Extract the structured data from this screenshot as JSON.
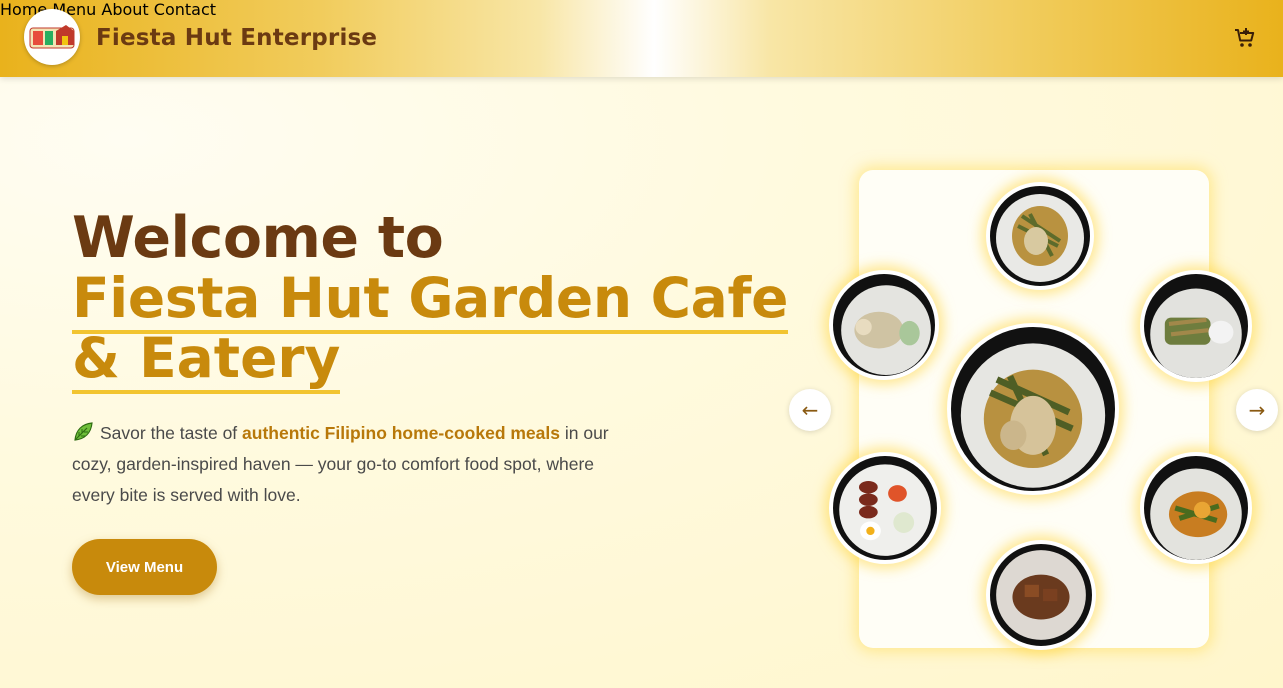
{
  "header": {
    "brand": "Fiesta Hut Enterprise",
    "nav": [
      {
        "label": "Home"
      },
      {
        "label": "Menu"
      },
      {
        "label": "About"
      },
      {
        "label": "Contact"
      }
    ],
    "cart_icon": "cart-icon"
  },
  "hero": {
    "title_line1": "Welcome to",
    "title_line2": "Fiesta Hut Garden Cafe",
    "title_line3": "& Eatery",
    "desc_prefix": "Savor the taste of ",
    "desc_highlight": "authentic Filipino home-cooked meals",
    "desc_suffix": " in our cozy, garden-inspired haven — your go-to comfort food spot, where every bite is served with love.",
    "cta_label": "View Menu"
  },
  "carousel": {
    "prev_label": "←",
    "next_label": "→",
    "dishes": [
      "dish-top",
      "dish-left-top",
      "dish-right-top",
      "dish-center",
      "dish-left-bottom",
      "dish-right-bottom",
      "dish-bottom"
    ]
  },
  "colors": {
    "brown": "#6b3a12",
    "gold": "#c88a0c",
    "underline": "#f2c430",
    "background": "#fffbe6"
  }
}
